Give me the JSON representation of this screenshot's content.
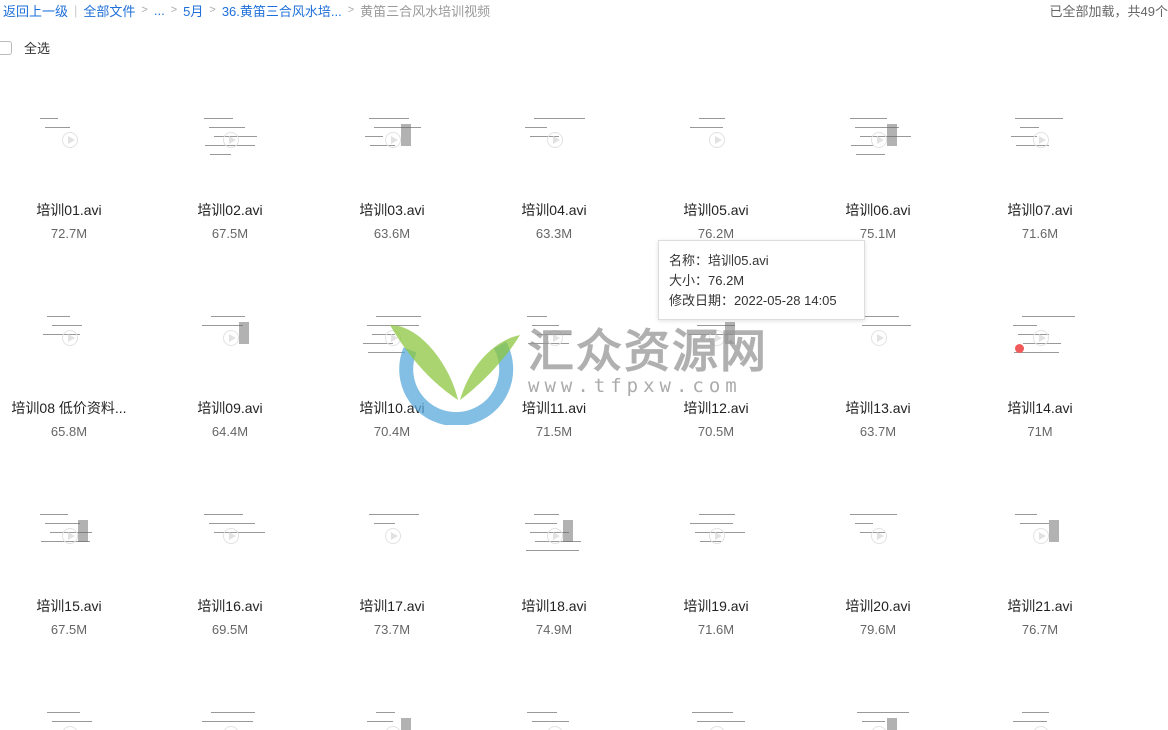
{
  "breadcrumb": {
    "back": "返回上一级",
    "items": [
      "全部文件",
      "...",
      "5月",
      "36.黄笛三合风水培..."
    ],
    "current": "黄笛三合风水培训视频"
  },
  "load_status": "已全部加载，共49个",
  "select_all_label": "全选",
  "files": [
    {
      "name": "培训01.avi",
      "size": "72.7M"
    },
    {
      "name": "培训02.avi",
      "size": "67.5M"
    },
    {
      "name": "培训03.avi",
      "size": "63.6M"
    },
    {
      "name": "培训04.avi",
      "size": "63.3M"
    },
    {
      "name": "培训05.avi",
      "size": "76.2M"
    },
    {
      "name": "培训06.avi",
      "size": "75.1M"
    },
    {
      "name": "培训07.avi",
      "size": "71.6M"
    },
    {
      "name": "培训08 低价资料...",
      "size": "65.8M"
    },
    {
      "name": "培训09.avi",
      "size": "64.4M"
    },
    {
      "name": "培训10.avi",
      "size": "70.4M"
    },
    {
      "name": "培训11.avi",
      "size": "71.5M"
    },
    {
      "name": "培训12.avi",
      "size": "70.5M"
    },
    {
      "name": "培训13.avi",
      "size": "63.7M"
    },
    {
      "name": "培训14.avi",
      "size": "71M"
    },
    {
      "name": "培训15.avi",
      "size": "67.5M"
    },
    {
      "name": "培训16.avi",
      "size": "69.5M"
    },
    {
      "name": "培训17.avi",
      "size": "73.7M"
    },
    {
      "name": "培训18.avi",
      "size": "74.9M"
    },
    {
      "name": "培训19.avi",
      "size": "71.6M"
    },
    {
      "name": "培训20.avi",
      "size": "79.6M"
    },
    {
      "name": "培训21.avi",
      "size": "76.7M"
    }
  ],
  "tooltip": {
    "name_line": "名称：培训05.avi",
    "size_line": "大小：76.2M",
    "date_line": "修改日期：2022-05-28 14:05"
  },
  "watermark": {
    "title": "汇众资源网",
    "url": "www.tfpxw.com"
  },
  "colors": {
    "link": "#1e6fd9",
    "logo_green": "#8cc63f",
    "logo_blue": "#5aa9dc"
  }
}
